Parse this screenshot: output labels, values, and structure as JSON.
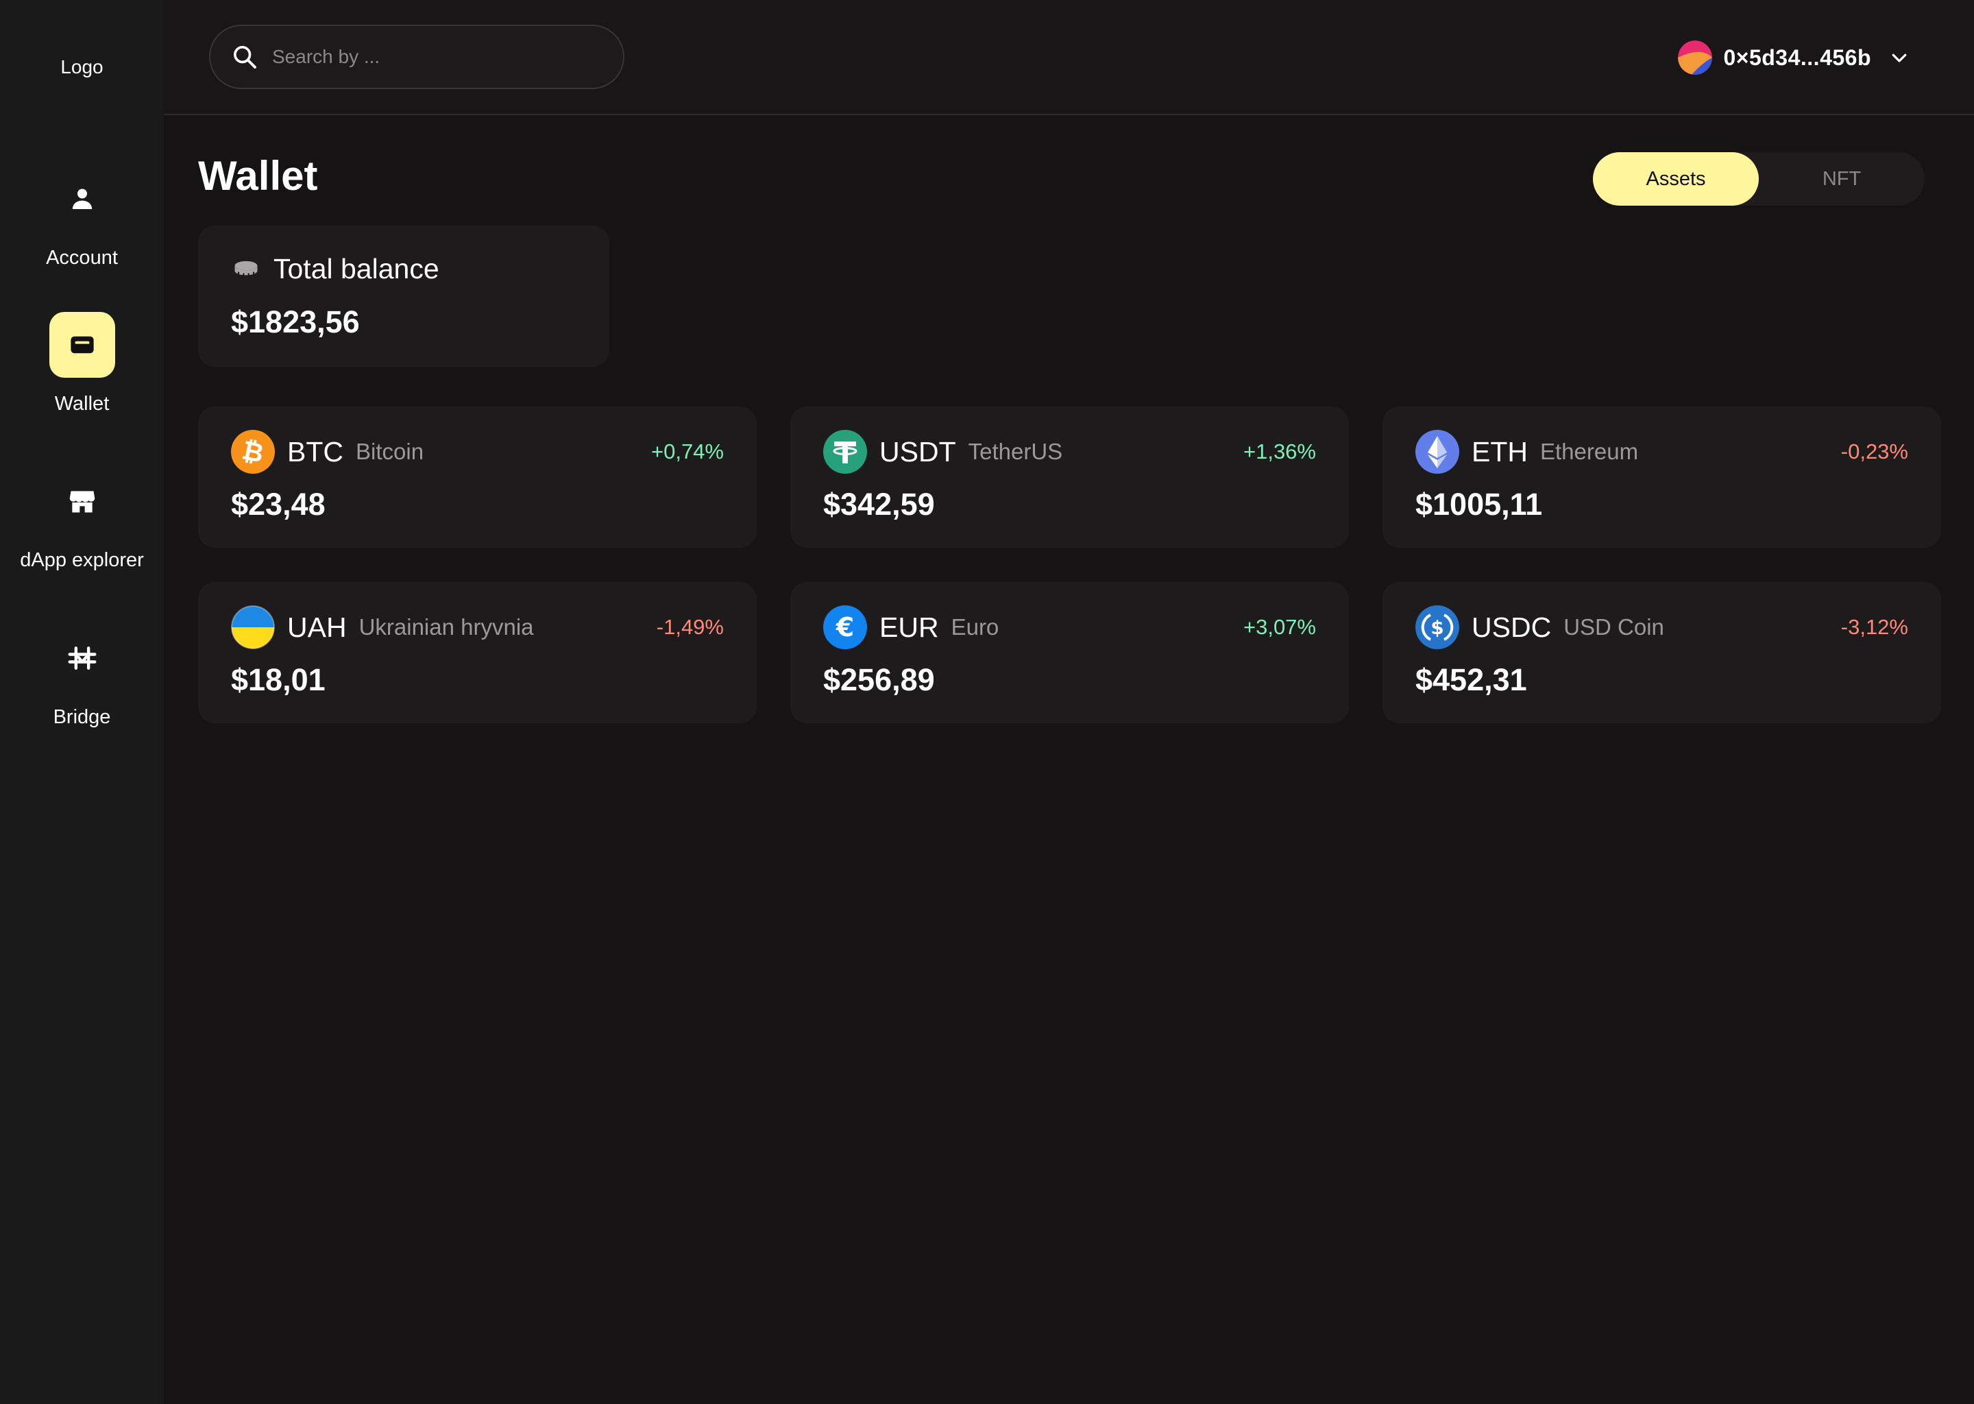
{
  "sidebar": {
    "logo": "Logo",
    "items": [
      {
        "label": "Account",
        "icon": "user-icon"
      },
      {
        "label": "Wallet",
        "icon": "wallet-icon"
      },
      {
        "label": "dApp explorer",
        "icon": "store-icon"
      },
      {
        "label": "Bridge",
        "icon": "bridge-icon"
      }
    ],
    "active_item": "Wallet"
  },
  "header": {
    "search_placeholder": "Search by ...",
    "account_address": "0×5d34...456b"
  },
  "main": {
    "title": "Wallet",
    "tabs": [
      {
        "label": "Assets",
        "active": true
      },
      {
        "label": "NFT",
        "active": false
      }
    ],
    "total_balance": {
      "label": "Total balance",
      "value": "$1823,56",
      "icon": "coin-stack-icon"
    },
    "assets": [
      {
        "symbol": "BTC",
        "name": "Bitcoin",
        "change": "+0,74%",
        "value": "$23,48",
        "icon": "bitcoin-icon",
        "trend": "up"
      },
      {
        "symbol": "USDT",
        "name": "TetherUS",
        "change": "+1,36%",
        "value": "$342,59",
        "icon": "tether-icon",
        "trend": "up"
      },
      {
        "symbol": "ETH",
        "name": "Ethereum",
        "change": "-0,23%",
        "value": "$1005,11",
        "icon": "ethereum-icon",
        "trend": "down"
      },
      {
        "symbol": "UAH",
        "name": "Ukrainian hryvnia",
        "change": "-1,49%",
        "value": "$18,01",
        "icon": "ukraine-flag-icon",
        "trend": "down"
      },
      {
        "symbol": "EUR",
        "name": "Euro",
        "change": "+3,07%",
        "value": "$256,89",
        "icon": "euro-icon",
        "trend": "up"
      },
      {
        "symbol": "USDC",
        "name": "USD Coin",
        "change": "-3,12%",
        "value": "$452,31",
        "icon": "usd-coin-icon",
        "trend": "down"
      }
    ]
  },
  "colors": {
    "background": "#151314",
    "sidebar": "#1b1a1b",
    "card": "#1d1b1c",
    "accent": "#fff59c",
    "positive": "#7ff0b5",
    "negative": "#ff8977"
  }
}
